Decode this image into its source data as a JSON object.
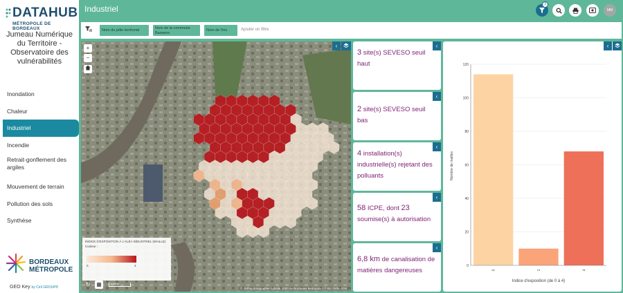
{
  "app": {
    "logo_main": "DATAHUB",
    "logo_sub": "MÉTROPOLE DE BORDEAUX",
    "subtitle": "Jumeau Numérique du Territoire - Observatoire des vulnérabilités",
    "partner_logo": "BORDEAUX MÉTROPOLE",
    "footer": "GEO Key",
    "footer_by": "by Ciril GROUP®"
  },
  "sidebar": {
    "items": [
      {
        "label": "Inondation",
        "active": false
      },
      {
        "label": "Chaleur",
        "active": false
      },
      {
        "label": "Industriel",
        "active": true
      },
      {
        "label": "Incendie",
        "active": false
      },
      {
        "label": "Retrait-gonflement des argiles",
        "active": false
      },
      {
        "label": "Mouvement de terrain",
        "active": false
      },
      {
        "label": "Pollution des sols",
        "active": false
      },
      {
        "label": "Synthèse",
        "active": false
      }
    ]
  },
  "header": {
    "title": "Industriel",
    "filter_badge": "3",
    "avatar": "MM",
    "icons": [
      "filter-icon",
      "search-icon",
      "print-icon",
      "screenshot-icon",
      "avatar"
    ]
  },
  "filters": {
    "chips": [
      "Nom du pôle territorial",
      "Nom de la commune Bassens",
      "Nom de l'iris"
    ],
    "chip_lines": [
      [
        "Nom du pôle territorial"
      ],
      [
        "Nom de la commune",
        "Bassens"
      ],
      [
        "Nom de l'iris"
      ]
    ],
    "add_placeholder": "Ajouter un filtre"
  },
  "map": {
    "zoom_in": "+",
    "zoom_out": "−",
    "legend_title": "INDICE D'EXPOSITION À L'ALÉA INDUSTRIEL (MAILLE)",
    "legend_color_label": "Couleur :",
    "legend_min": "0",
    "legend_max": "4",
    "scale": "1000 m",
    "attribution": "© Orthophotographie hybride 2020 de Bordeaux Métropole | © BD Ortho IGN",
    "colors": {
      "low": "#fbe9d9",
      "mid": "#f5b98f",
      "high": "#b8171c"
    }
  },
  "cards": [
    {
      "num": "3",
      "text": " site(s) SEVESO seuil haut"
    },
    {
      "num": "2",
      "text": " site(s) SEVESO seuil bas"
    },
    {
      "num": "4",
      "text": " installation(s) industrielle(s) rejetant des polluants"
    },
    {
      "num": "58",
      "text": " ICPE, dont ",
      "num2": "23",
      "text2": " soumise(s) à autorisation"
    },
    {
      "num": "6,8 km",
      "text": " de canalisation de matières dangereuses"
    }
  ],
  "chart_data": {
    "type": "bar",
    "categories": [
      "0",
      "1",
      "4"
    ],
    "values": [
      114,
      10,
      68
    ],
    "colors": [
      "#fdd3a4",
      "#fca479",
      "#ee7058"
    ],
    "xlabel": "Indice d'exposition (de 0 à 4)",
    "ylabel": "Nombre de mailles",
    "ylim": [
      0,
      120
    ],
    "yticks": [
      0,
      20,
      40,
      60,
      80,
      100,
      120
    ],
    "grid": true
  }
}
